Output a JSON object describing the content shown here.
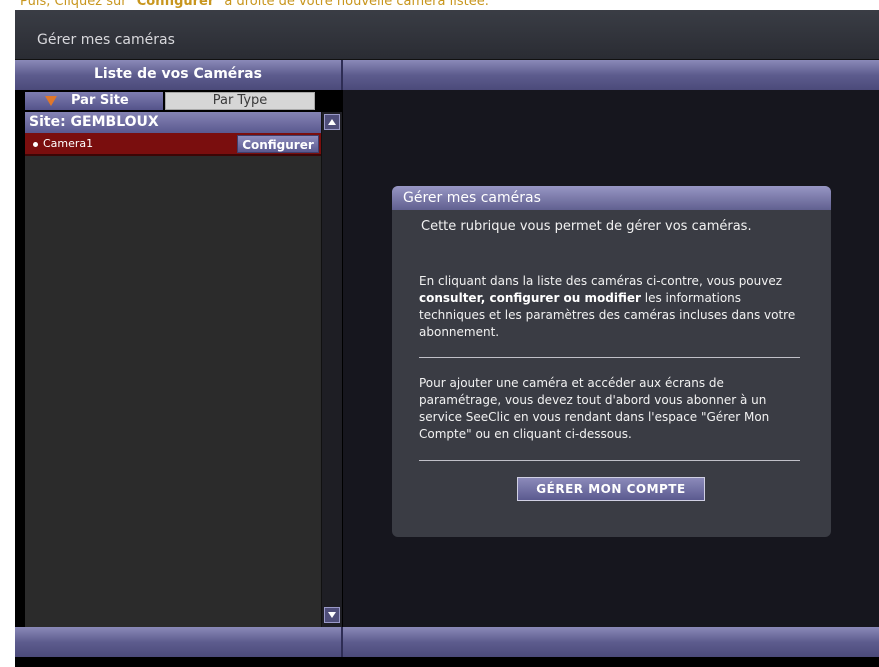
{
  "instruction": {
    "prefix": "Puis, Cliquez sur \"",
    "bold": "Configurer",
    "suffix": "\" à droite de votre nouvelle caméra listée."
  },
  "window": {
    "title": "Gérer mes caméras"
  },
  "list": {
    "title": "Liste de vos Caméras",
    "tabs": [
      {
        "label": "Par Site",
        "active": true
      },
      {
        "label": "Par Type",
        "active": false
      }
    ],
    "site_header": "Site: GEMBLOUX",
    "cameras": [
      {
        "name": "Camera1",
        "action": "Configurer"
      }
    ]
  },
  "card": {
    "title": "Gérer mes caméras",
    "lead": "Cette rubrique vous permet de gérer vos caméras.",
    "p1": {
      "before": "En cliquant dans la liste des caméras ci-contre, vous pouvez ",
      "bold": "consulter, configurer ou modifier",
      "after": " les informations techniques et les paramètres des caméras incluses dans votre abonnement."
    },
    "p2": "Pour ajouter une caméra et accéder aux écrans de paramétrage, vous devez tout d'abord vous abonner à un service SeeClic en vous rendant dans l'espace \"Gérer Mon Compte\" ou en cliquant ci-dessous.",
    "button": "GÉRER MON COMPTE"
  },
  "colors": {
    "accent": "#5d5c8e",
    "selected_row": "#7a0e0e",
    "instruction_text": "#c8961e"
  }
}
